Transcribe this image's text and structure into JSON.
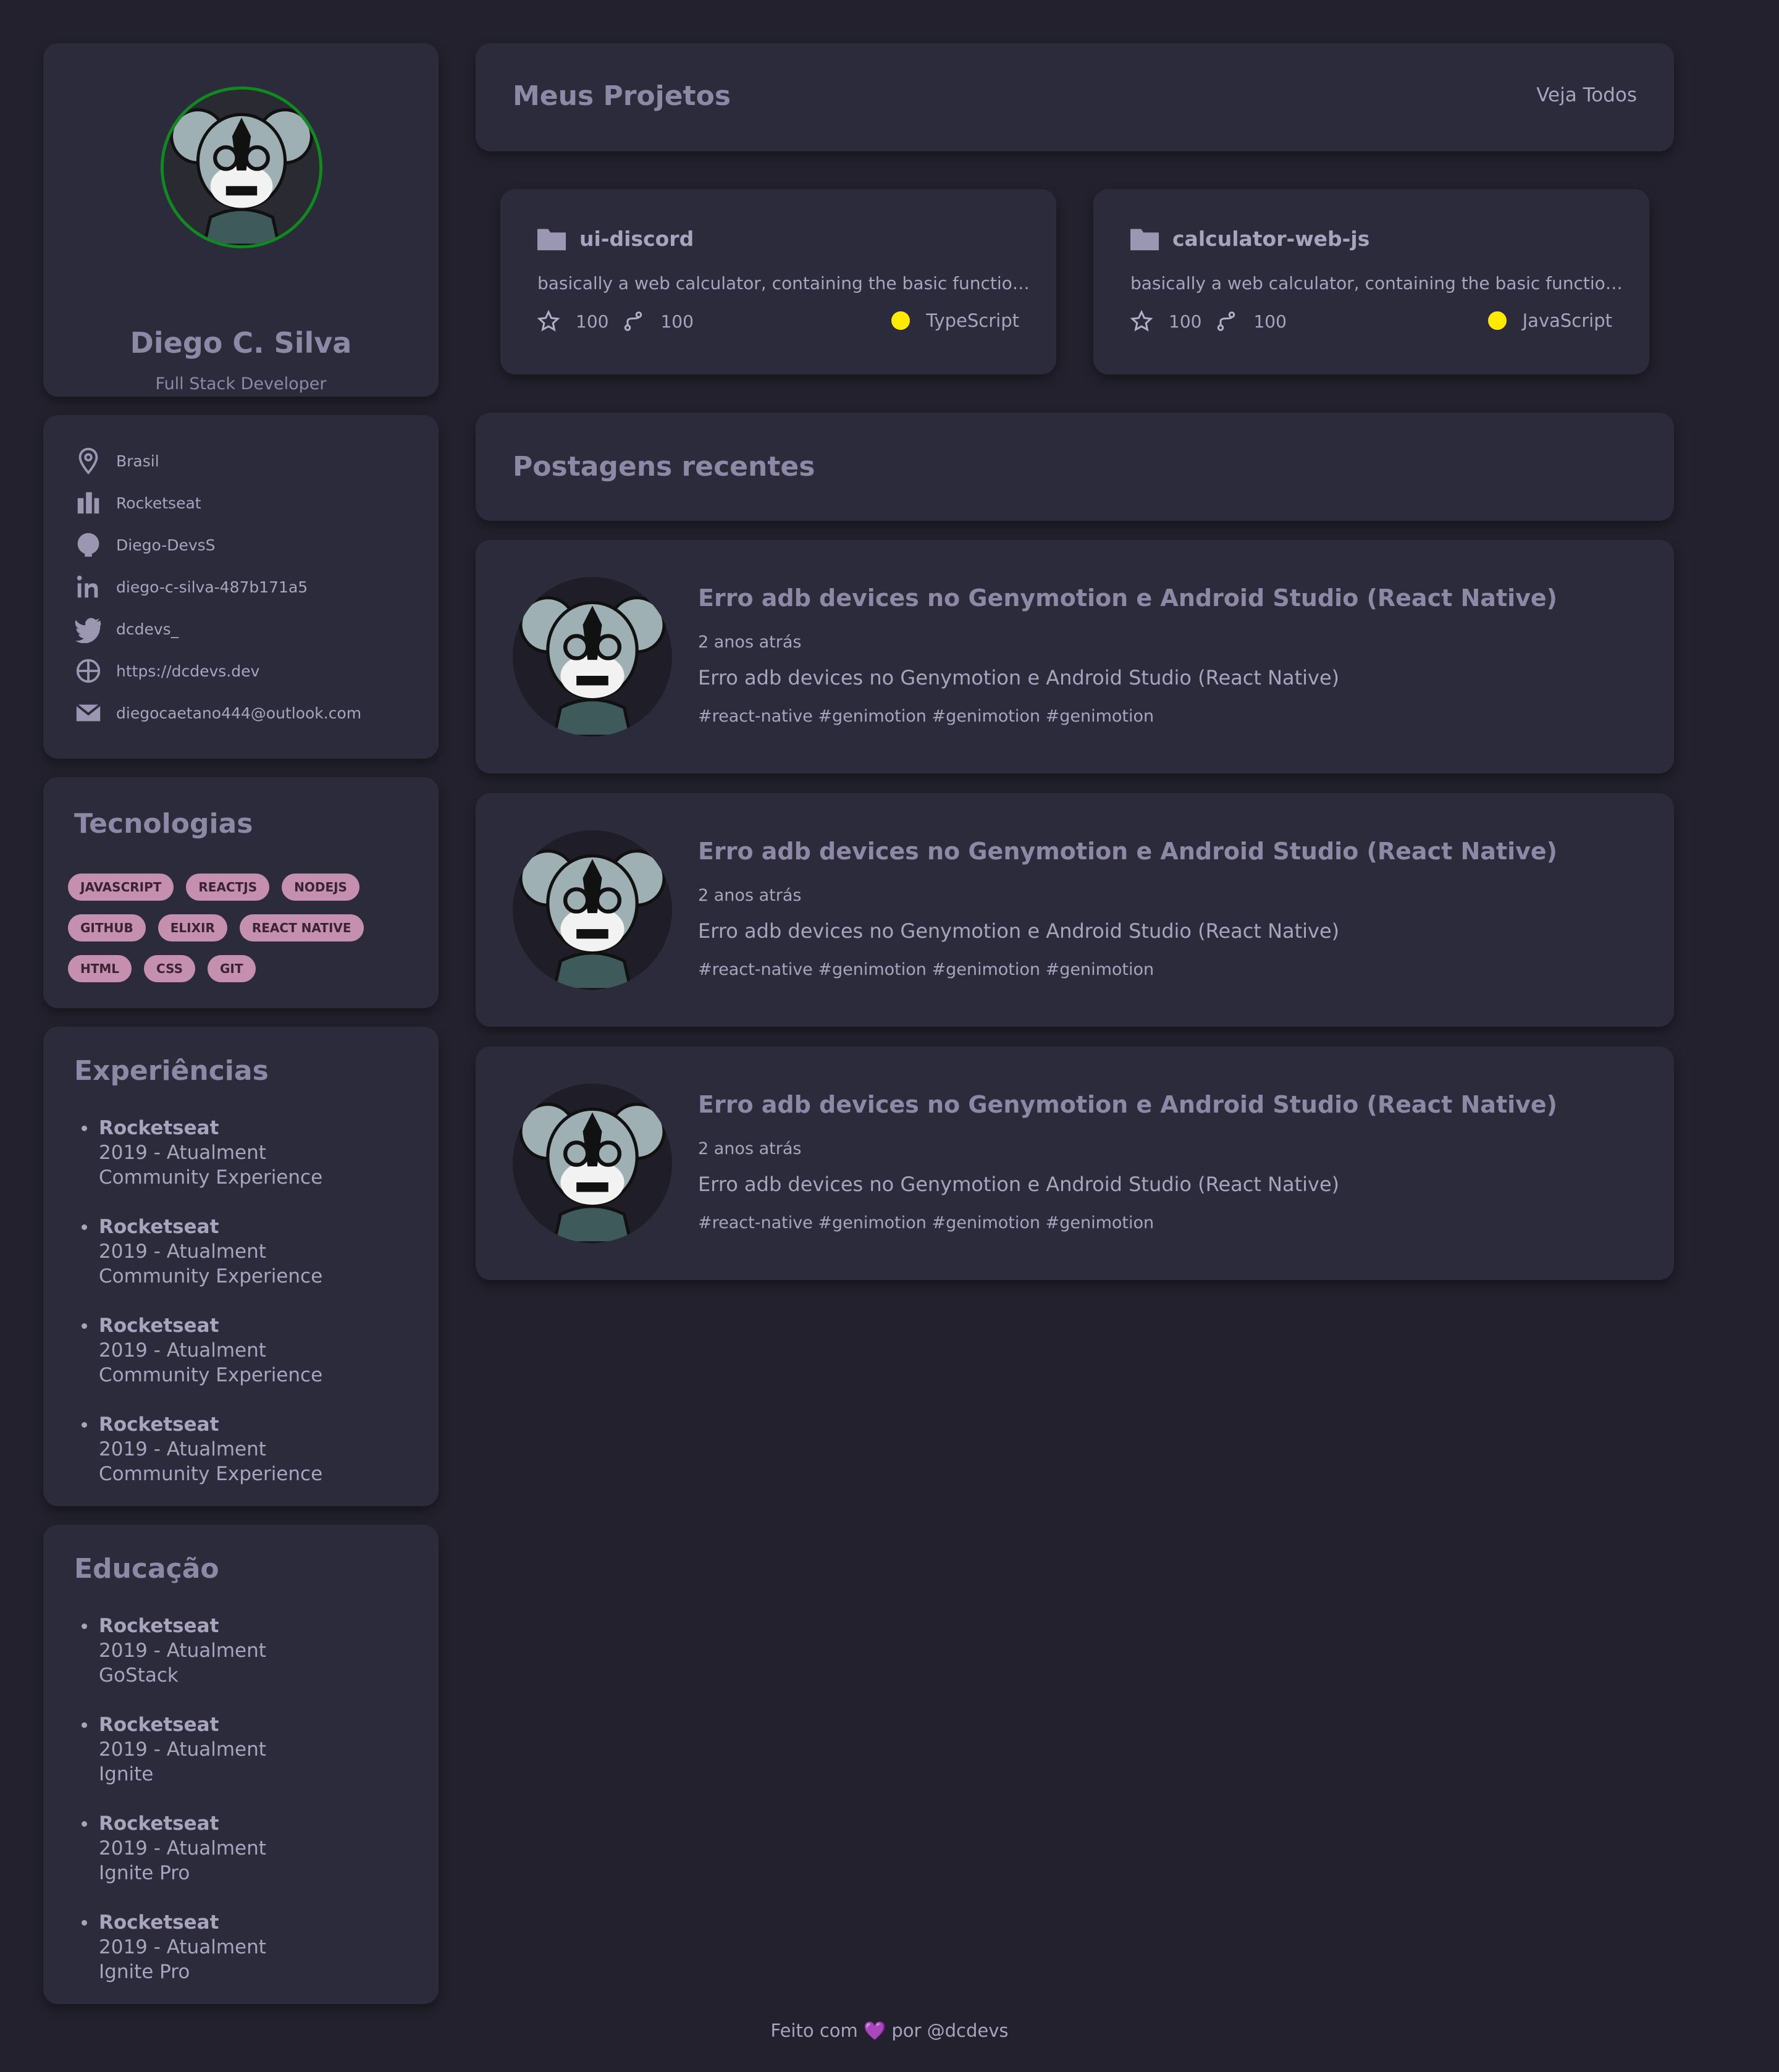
{
  "profile": {
    "name": "Diego C. Silva",
    "role": "Full Stack Developer"
  },
  "info": {
    "location": "Brasil",
    "company": "Rocketseat",
    "github": "Diego-DevsS",
    "linkedin": "diego-c-silva-487b171a5",
    "twitter": "dcdevs_",
    "website": "https://dcdevs.dev",
    "email": "diegocaetano444@outlook.com"
  },
  "tech": {
    "title": "Tecnologias",
    "tags": [
      "JAVASCRIPT",
      "REACTJS",
      "NODEJS",
      "GITHUB",
      "ELIXIR",
      "REACT NATIVE",
      "HTML",
      "CSS",
      "GIT"
    ]
  },
  "experiences": {
    "title": "Experiências",
    "items": [
      {
        "company": "Rocketseat",
        "period": "2019 - Atualment",
        "role": "Community Experience"
      },
      {
        "company": "Rocketseat",
        "period": "2019 - Atualment",
        "role": "Community Experience"
      },
      {
        "company": "Rocketseat",
        "period": "2019 - Atualment",
        "role": "Community Experience"
      },
      {
        "company": "Rocketseat",
        "period": "2019 - Atualment",
        "role": "Community Experience"
      }
    ]
  },
  "education": {
    "title": "Educação",
    "items": [
      {
        "company": "Rocketseat",
        "period": "2019 - Atualment",
        "course": "GoStack"
      },
      {
        "company": "Rocketseat",
        "period": "2019 - Atualment",
        "course": "Ignite"
      },
      {
        "company": "Rocketseat",
        "period": "2019 - Atualment",
        "course": "Ignite Pro"
      },
      {
        "company": "Rocketseat",
        "period": "2019 - Atualment",
        "course": "Ignite Pro"
      }
    ]
  },
  "projects": {
    "title": "Meus Projetos",
    "see_all": "Veja Todos",
    "items": [
      {
        "name": "ui-discord",
        "description": "basically a web calculator, containing the basic functionalities",
        "stars": "100",
        "forks": "100",
        "language": "TypeScript",
        "language_color": "#ffea00"
      },
      {
        "name": "calculator-web-js",
        "description": "basically a web calculator, containing the basic functionalities",
        "stars": "100",
        "forks": "100",
        "language": "JavaScript",
        "language_color": "#ffea00"
      }
    ]
  },
  "posts": {
    "title": "Postagens recentes",
    "items": [
      {
        "title": "Erro adb devices no Genymotion e Android Studio (React Native)",
        "time": "2 anos atrás",
        "body": "Erro adb devices no Genymotion e Android Studio (React Native)",
        "tags": "#react-native #genimotion #genimotion #genimotion"
      },
      {
        "title": "Erro adb devices no Genymotion e Android Studio (React Native)",
        "time": "2 anos atrás",
        "body": "Erro adb devices no Genymotion e Android Studio (React Native)",
        "tags": "#react-native #genimotion #genimotion #genimotion"
      },
      {
        "title": "Erro adb devices no Genymotion e Android Studio (React Native)",
        "time": "2 anos atrás",
        "body": "Erro adb devices no Genymotion e Android Studio (React Native)",
        "tags": "#react-native #genimotion #genimotion #genimotion"
      }
    ]
  },
  "footer": {
    "prefix": "Feito com",
    "heart": "💜",
    "suffix": "por @dcdevs"
  }
}
